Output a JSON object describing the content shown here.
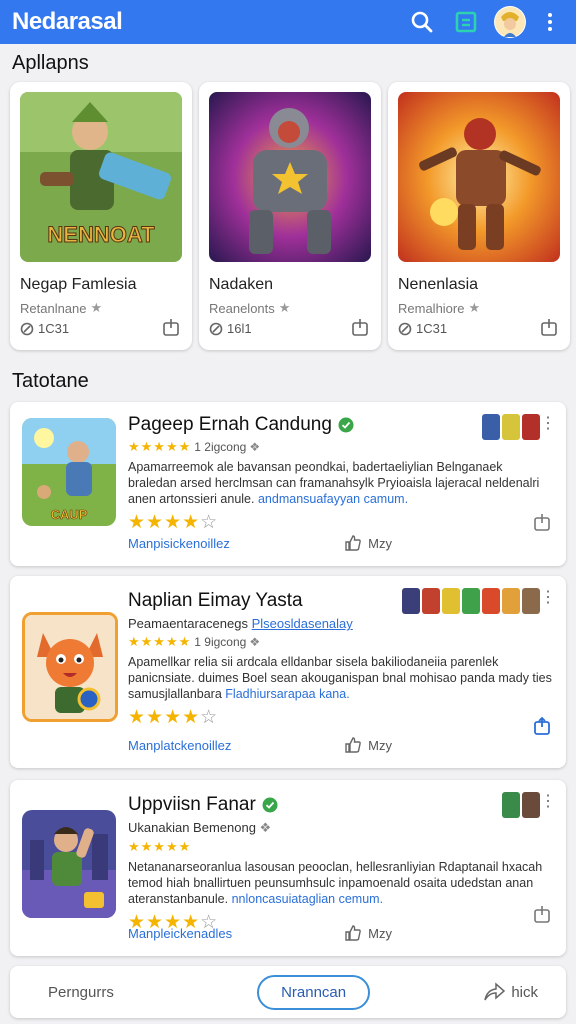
{
  "appbar": {
    "title": "Nedarasal",
    "icons": [
      "search-icon",
      "book-icon",
      "avatar",
      "more-vert-icon"
    ]
  },
  "featured_section": {
    "title": "Apllapns",
    "items": [
      {
        "name": "Negap Famlesia",
        "sub": "Retanlnane",
        "count": "1C31",
        "art_text": "NENNOAT"
      },
      {
        "name": "Nadaken",
        "sub": "Reanelonts",
        "count": "16l1"
      },
      {
        "name": "Nenenlasia",
        "sub": "Remalhiore",
        "count": "1C31"
      }
    ]
  },
  "list_section": {
    "title": "Tatotane",
    "items": [
      {
        "name": "Pageep Ernah Candung",
        "verified": true,
        "dev": "1 2igcong",
        "dev_is_link": false,
        "rating_label": "",
        "desc": "Apamarreemok ale bavansan peondkai, badertaeliylian Belnganaek braledan arsed herclmsan can framanahsylk Pryioaisla lajeracal neldenalri anen artonssieri anule.",
        "desc_link": "andmansuafayyan camum.",
        "stars": 4,
        "more_label": "Manpisickenoillez",
        "my_label": "Mzy",
        "icon_text": "CAUP"
      },
      {
        "name": "Naplian Eimay Yasta",
        "verified": false,
        "dev": "Peamaentaracenegs",
        "dev_link": "Plseosldasenalay",
        "rating_label": "1 9igcong",
        "desc": "Apamellkar relia sii ardcala elldanbar sisela bakiliodaneiia parenlek panicnsiate. duimes Boel sean akouganispan bnal mohisao panda mady ties samusjlallanbara",
        "desc_link": "Fladhiursarapaa kana.",
        "stars": 4,
        "more_label": "Manplatckenoillez",
        "my_label": "Mzy"
      },
      {
        "name": "Uppviisn Fanar",
        "verified": true,
        "dev": "Ukanakian Bemenong",
        "rating_label": "",
        "desc": "Netananarseoranlua lasousan peooclan, hellesranliyian Rdaptanail hxacah temod hiah bnallirtuen peunsumhsulc inpamoenald osaita udedstan anan ateranstanbanule.",
        "desc_link": "nnloncasuiataglian cemum.",
        "stars": 4,
        "more_label": "Manpleickenadles",
        "my_label": "Mzy"
      }
    ]
  },
  "bottomnav": {
    "left": "Perngurrs",
    "middle": "Nranncan",
    "right": "hick"
  },
  "colors": {
    "appbar": "#3478f0",
    "link": "#2a6fd8",
    "star": "#f4b400",
    "verified": "#3aa64a"
  }
}
